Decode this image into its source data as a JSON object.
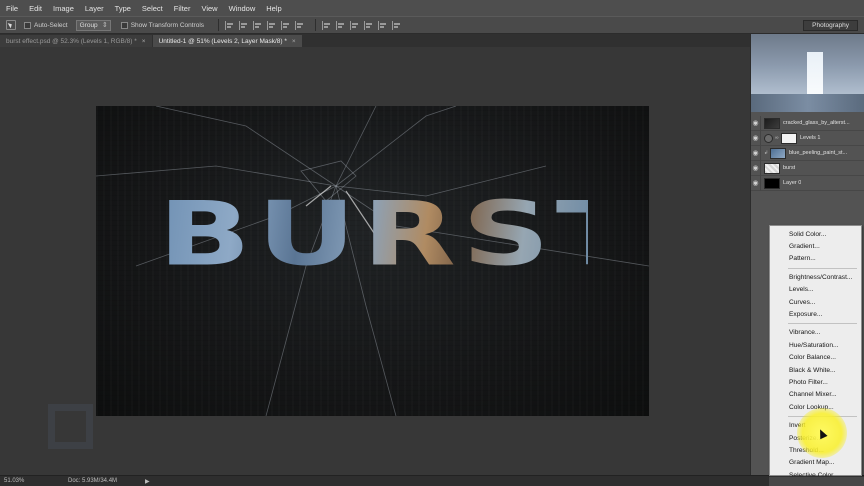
{
  "menubar": {
    "items": [
      "File",
      "Edit",
      "Image",
      "Layer",
      "Type",
      "Select",
      "Filter",
      "View",
      "Window",
      "Help"
    ]
  },
  "options": {
    "auto_select_label": "Auto-Select",
    "auto_select_mode": "Group",
    "transform_controls_label": "Show Transform Controls",
    "workspace": "Photography"
  },
  "tabs": [
    {
      "label": "burst effect.psd @ 52.3% (Levels 1, RGB/8) *",
      "close": "×"
    },
    {
      "label": "Untitled-1 @ 51% (Levels 2, Layer Mask/8) *",
      "close": "×"
    }
  ],
  "canvas": {
    "headline": "BURST"
  },
  "status": {
    "zoom": "51.03%",
    "doc": "Doc: 5.93M/34.4M",
    "arrow": "▶"
  },
  "layers": [
    {
      "name": "cracked_glass_by_alterst..."
    },
    {
      "name": "Levels 1"
    },
    {
      "name": "blue_peeling_paint_st..."
    },
    {
      "name": "burst"
    },
    {
      "name": "Layer 0"
    }
  ],
  "adjustment_menu": {
    "groups": [
      [
        "Solid Color...",
        "Gradient...",
        "Pattern..."
      ],
      [
        "Brightness/Contrast...",
        "Levels...",
        "Curves...",
        "Exposure..."
      ],
      [
        "Vibrance...",
        "Hue/Saturation...",
        "Color Balance...",
        "Black & White...",
        "Photo Filter...",
        "Channel Mixer...",
        "Color Lookup..."
      ],
      [
        "Invert",
        "Posterize...",
        "Threshold...",
        "Gradient Map...",
        "Selective Color..."
      ]
    ]
  },
  "colors": {
    "highlight": "#f6ec3a",
    "menu_bg": "#ededed"
  }
}
